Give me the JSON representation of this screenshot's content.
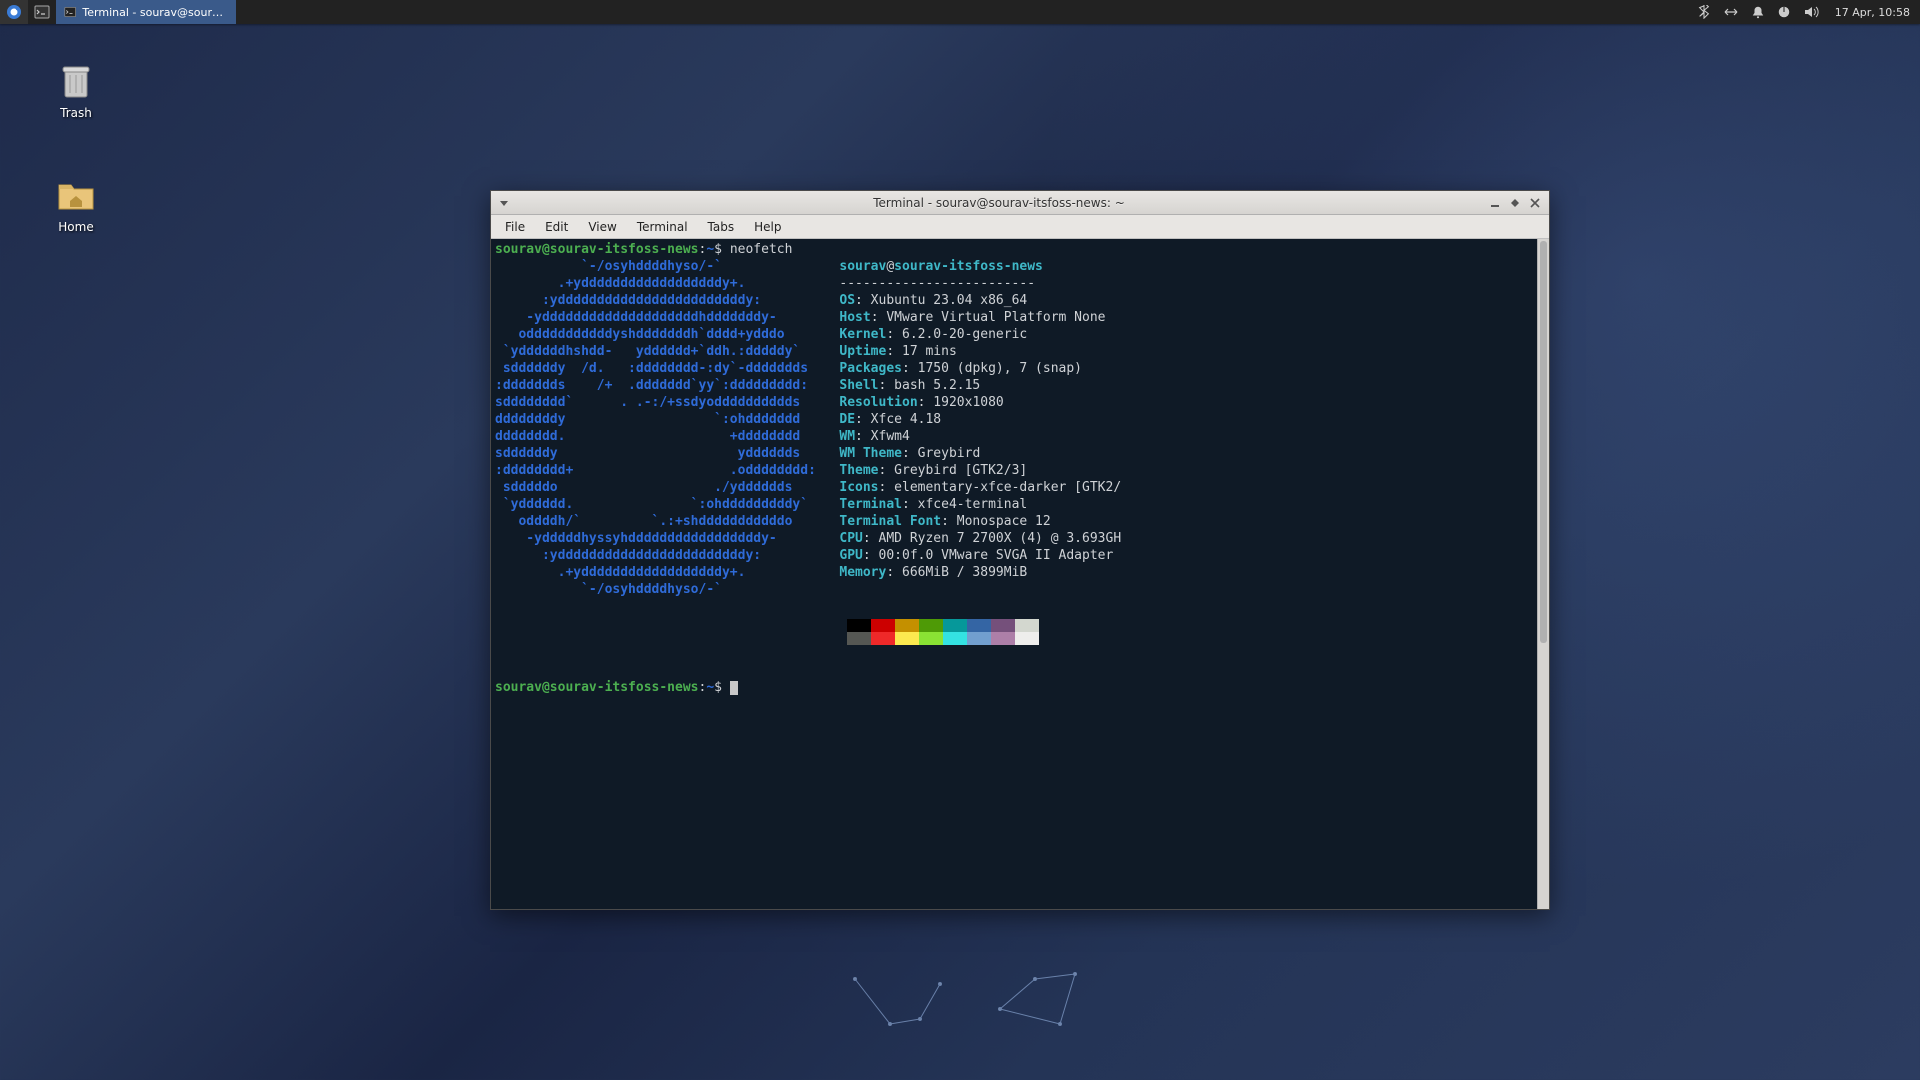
{
  "panel": {
    "task_label": "Terminal - sourav@sourav-it...",
    "clock": "17 Apr, 10:58"
  },
  "desktop_icons": {
    "trash": "Trash",
    "home": "Home"
  },
  "window": {
    "title": "Terminal - sourav@sourav-itsfoss-news: ~",
    "menus": [
      "File",
      "Edit",
      "View",
      "Terminal",
      "Tabs",
      "Help"
    ]
  },
  "prompt": {
    "userhost": "sourav@sourav-itsfoss-news",
    "colon": ":",
    "cwd": "~",
    "dollar": "$ ",
    "cmd": "neofetch"
  },
  "header": {
    "user": "sourav",
    "at": "@",
    "host": "sourav-itsfoss-news",
    "dashline": "-------------------------"
  },
  "logo": [
    "           `-/osyhddddhyso/-`",
    "        .+yddddddddddddddddddy+.",
    "      :yddddddddddddddddddddddddy:",
    "    -yddddddddddddddddddddhdddddddy-",
    "   odddddddddddyshdddddddh`dddd+ydddo",
    " `yddddddhshdd-   ydddddd+`ddh.:dddddy`",
    " sddddddy  /d.   :dddddddd-:dy`-ddddddds",
    ":ddddddds    /+  .ddddddd`yy`:ddddddddd:",
    "sdddddddd`      . .-:/+ssdyodddddddddds",
    "ddddddddy                   `:ohddddddd",
    "dddddddd.                     +dddddddd",
    "sddddddy                       ydddddds",
    ":dddddddd+                    .odddddddd:",
    " sdddddo                    ./ydddddds",
    " `ydddddd.               `:ohdddddddddy`",
    "   oddddh/`         `.:+shdddddddddddo",
    "    -ydddddhyssyhdddddddddddddddddy-",
    "      :yddddddddddddddddddddddddy:",
    "        .+yddddddddddddddddddy+.",
    "           `-/osyhddddhyso/-`"
  ],
  "info": [
    {
      "k": "OS",
      "v": "Xubuntu 23.04 x86_64"
    },
    {
      "k": "Host",
      "v": "VMware Virtual Platform None"
    },
    {
      "k": "Kernel",
      "v": "6.2.0-20-generic"
    },
    {
      "k": "Uptime",
      "v": "17 mins"
    },
    {
      "k": "Packages",
      "v": "1750 (dpkg), 7 (snap)"
    },
    {
      "k": "Shell",
      "v": "bash 5.2.15"
    },
    {
      "k": "Resolution",
      "v": "1920x1080"
    },
    {
      "k": "DE",
      "v": "Xfce 4.18"
    },
    {
      "k": "WM",
      "v": "Xfwm4"
    },
    {
      "k": "WM Theme",
      "v": "Greybird"
    },
    {
      "k": "Theme",
      "v": "Greybird [GTK2/3]"
    },
    {
      "k": "Icons",
      "v": "elementary-xfce-darker [GTK2/"
    },
    {
      "k": "Terminal",
      "v": "xfce4-terminal"
    },
    {
      "k": "Terminal Font",
      "v": "Monospace 12"
    },
    {
      "k": "CPU",
      "v": "AMD Ryzen 7 2700X (4) @ 3.693GH"
    },
    {
      "k": "GPU",
      "v": "00:0f.0 VMware SVGA II Adapter"
    },
    {
      "k": "Memory",
      "v": "666MiB / 3899MiB"
    }
  ],
  "swatches_dark": [
    "#000000",
    "#cc0000",
    "#c49000",
    "#4e9a06",
    "#06989a",
    "#3465a4",
    "#75507b",
    "#d3d7cf"
  ],
  "swatches_light": [
    "#555753",
    "#ef2929",
    "#fce94f",
    "#8ae234",
    "#34e2e2",
    "#729fcf",
    "#ad7fa8",
    "#eeeeec"
  ]
}
